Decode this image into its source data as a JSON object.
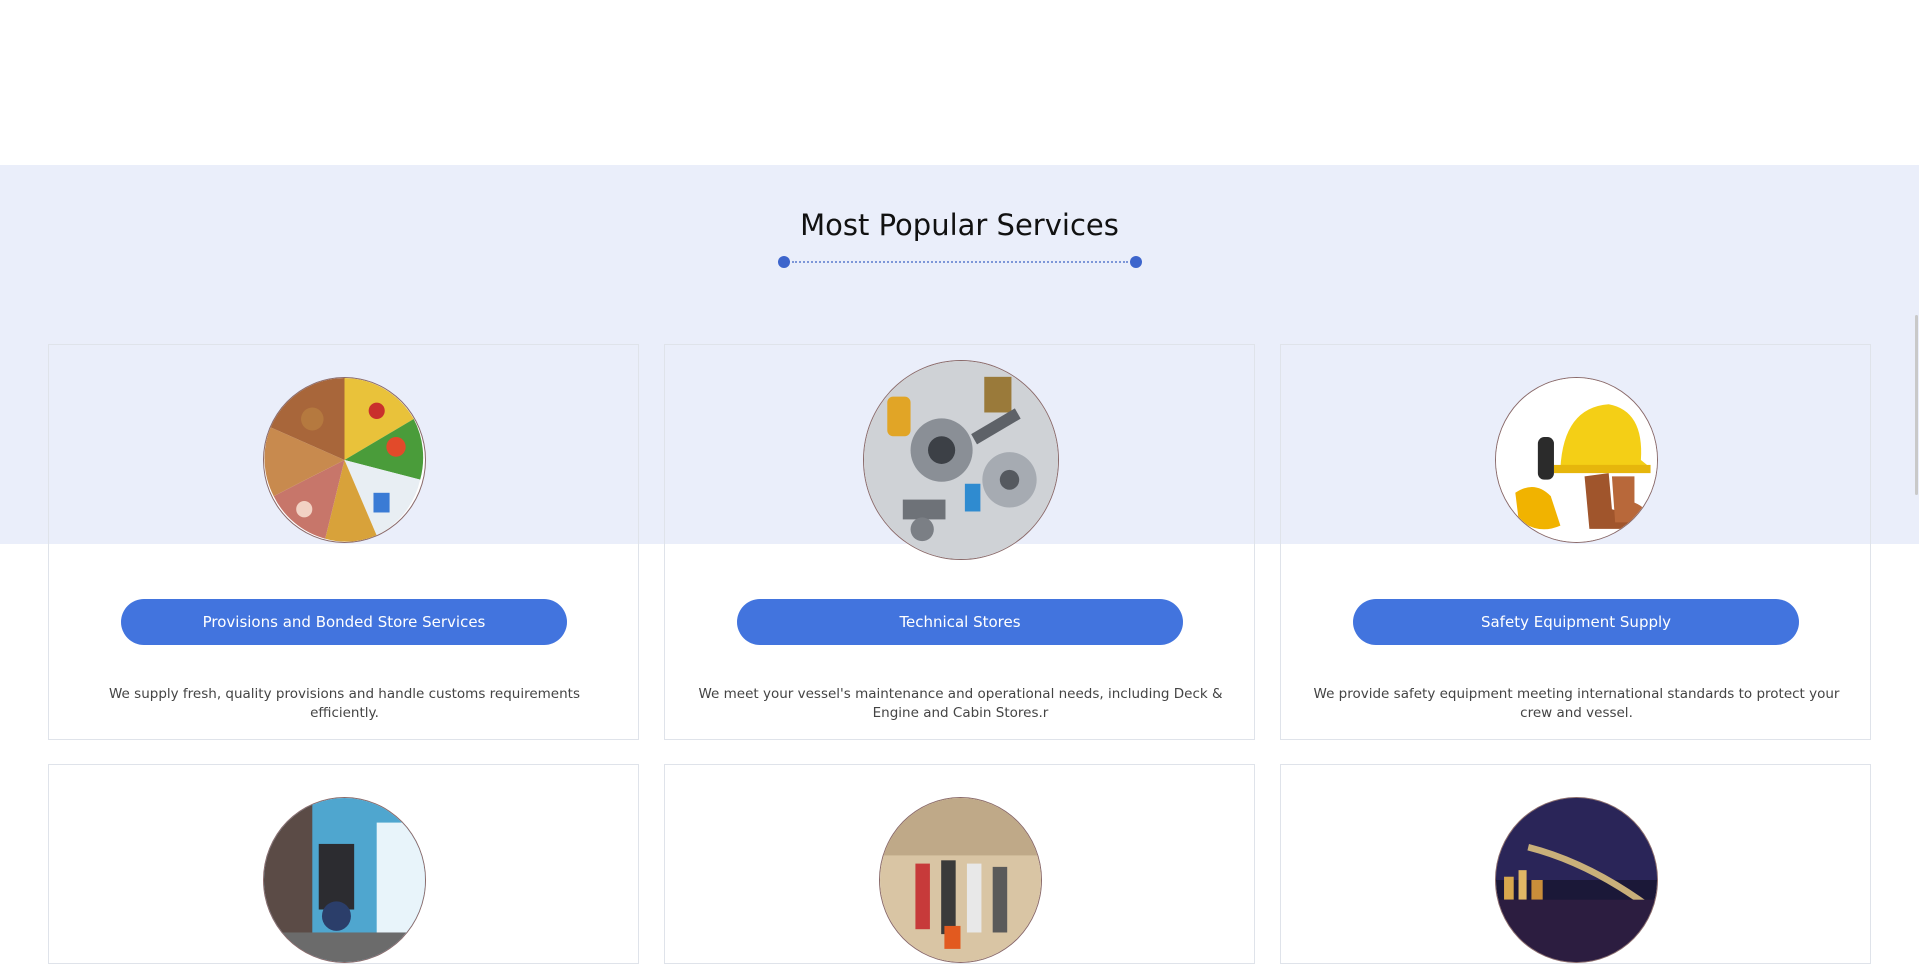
{
  "section": {
    "title": "Most Popular Services"
  },
  "services": [
    {
      "title": "Provisions and Bonded Store Services",
      "description": "We supply fresh, quality provisions and handle customs requirements efficiently.",
      "image_icon": "food-provisions-image"
    },
    {
      "title": "Technical Stores",
      "description": "We meet your vessel's maintenance and operational needs, including Deck & Engine and Cabin Stores.r",
      "image_icon": "machine-parts-image"
    },
    {
      "title": "Safety Equipment Supply",
      "description": "We provide safety equipment meeting international standards to protect your crew and vessel.",
      "image_icon": "safety-gear-image"
    },
    {
      "image_icon": "port-logistics-image"
    },
    {
      "image_icon": "crew-change-image"
    },
    {
      "image_icon": "city-bridge-image"
    }
  ],
  "colors": {
    "accent": "#4274de",
    "band_background": "#eaeefa",
    "divider_dot": "#3d65cc"
  }
}
